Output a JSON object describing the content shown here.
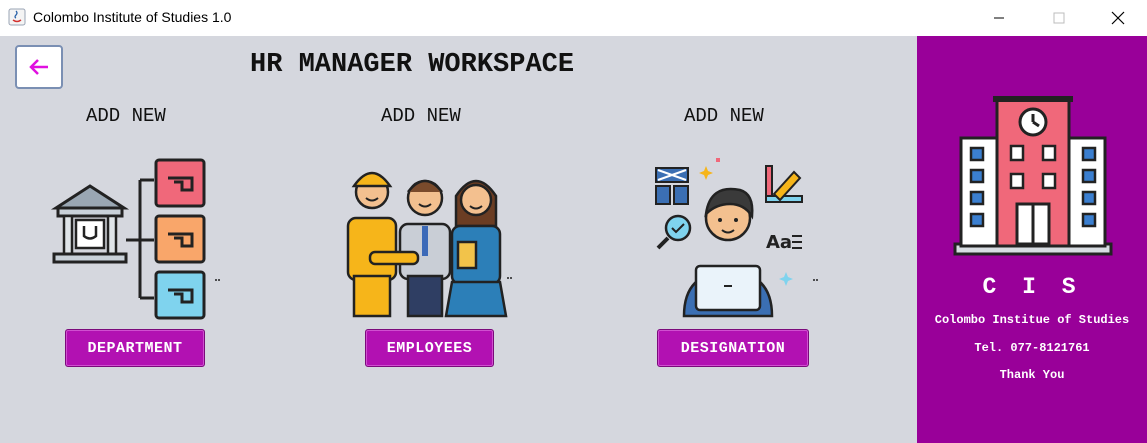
{
  "window": {
    "title": "Colombo Institute of Studies 1.0",
    "icons": [
      "java-app-icon",
      "minimize-icon",
      "maximize-icon",
      "close-icon"
    ]
  },
  "header": {
    "back_icon": "arrow-left-icon",
    "title": "HR MANAGER WORKSPACE"
  },
  "cards": [
    {
      "heading": "ADD NEW",
      "button_label": "DEPARTMENT",
      "icon": "department-hierarchy-icon"
    },
    {
      "heading": "ADD NEW",
      "button_label": "EMPLOYEES",
      "icon": "employees-group-icon"
    },
    {
      "heading": "ADD NEW",
      "button_label": "DESIGNATION",
      "icon": "designer-at-laptop-icon"
    }
  ],
  "sidebar": {
    "logo_icon": "school-building-icon",
    "abbrev": "C I S",
    "name": "Colombo Institue of Studies",
    "tel": "Tel. 077-8121761",
    "thanks": "Thank You"
  },
  "colors": {
    "panel_bg": "#d5d7de",
    "sidebar_bg": "#990099",
    "button_bg": "#b211b2",
    "back_arrow": "#e010e0"
  }
}
